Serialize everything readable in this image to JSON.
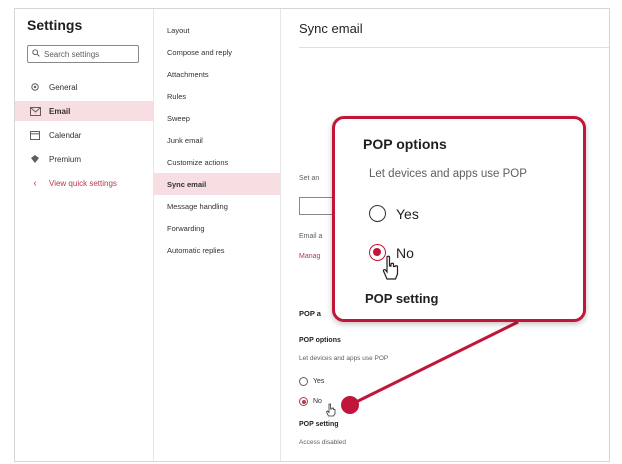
{
  "left_column": {
    "title": "Settings",
    "search_placeholder": "Search settings",
    "items": [
      {
        "label": "General",
        "icon": "gear-icon"
      },
      {
        "label": "Email",
        "icon": "mail-icon"
      },
      {
        "label": "Calendar",
        "icon": "calendar-icon"
      },
      {
        "label": "Premium",
        "icon": "diamond-icon"
      },
      {
        "label": "View quick settings",
        "icon": "chevron-left-icon"
      }
    ],
    "active_index": 1
  },
  "middle_column": {
    "items": [
      "Layout",
      "Compose and reply",
      "Attachments",
      "Rules",
      "Sweep",
      "Junk email",
      "Customize actions",
      "Sync email",
      "Message handling",
      "Forwarding",
      "Automatic replies"
    ],
    "active_index": 7
  },
  "right_panel": {
    "title": "Sync email",
    "faint_set_label": "Set an",
    "faint_email_label": "Email a",
    "faint_manage_link": "Manag",
    "pop_section_title": "POP a",
    "pop_options_label": "POP options",
    "pop_options_desc": "Let devices and apps use POP",
    "yes_label": "Yes",
    "no_label": "No",
    "selected": "No",
    "pop_setting_label": "POP setting",
    "pop_setting_value": "Access disabled"
  },
  "callout": {
    "title": "POP options",
    "description": "Let devices and apps use POP",
    "yes_label": "Yes",
    "no_label": "No",
    "selected": "No",
    "setting_label": "POP setting"
  },
  "colors": {
    "accent": "#c1163a",
    "active_bg": "#f6dee3",
    "link": "#b43a4d"
  }
}
